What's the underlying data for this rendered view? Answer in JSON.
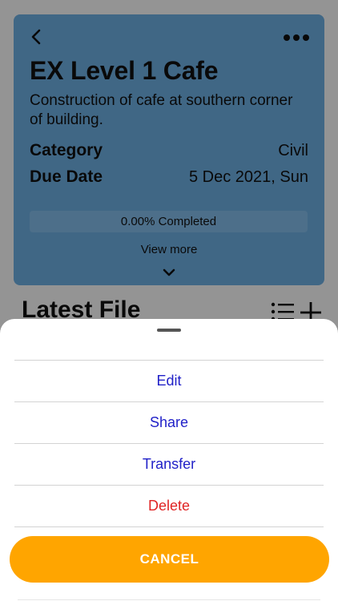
{
  "project": {
    "title": "EX Level 1 Cafe",
    "description": "Construction of cafe at southern corner of building.",
    "category_label": "Category",
    "category_value": "Civil",
    "due_label": "Due Date",
    "due_value": "5 Dec 2021, Sun",
    "progress_fraction": 0.0,
    "progress_text": "0.00% Completed",
    "view_more": "View more",
    "card_color": "#6fb1e6"
  },
  "section": {
    "title": "Latest File",
    "icons": [
      "list-icon",
      "plus-icon"
    ]
  },
  "action_sheet": {
    "items": [
      {
        "label": "Edit",
        "color": "#2121c8"
      },
      {
        "label": "Share",
        "color": "#2121c8"
      },
      {
        "label": "Transfer",
        "color": "#2121c8"
      },
      {
        "label": "Delete",
        "color": "#e02424"
      }
    ],
    "cancel_label": "CANCEL",
    "cancel_color": "#ffa500"
  }
}
